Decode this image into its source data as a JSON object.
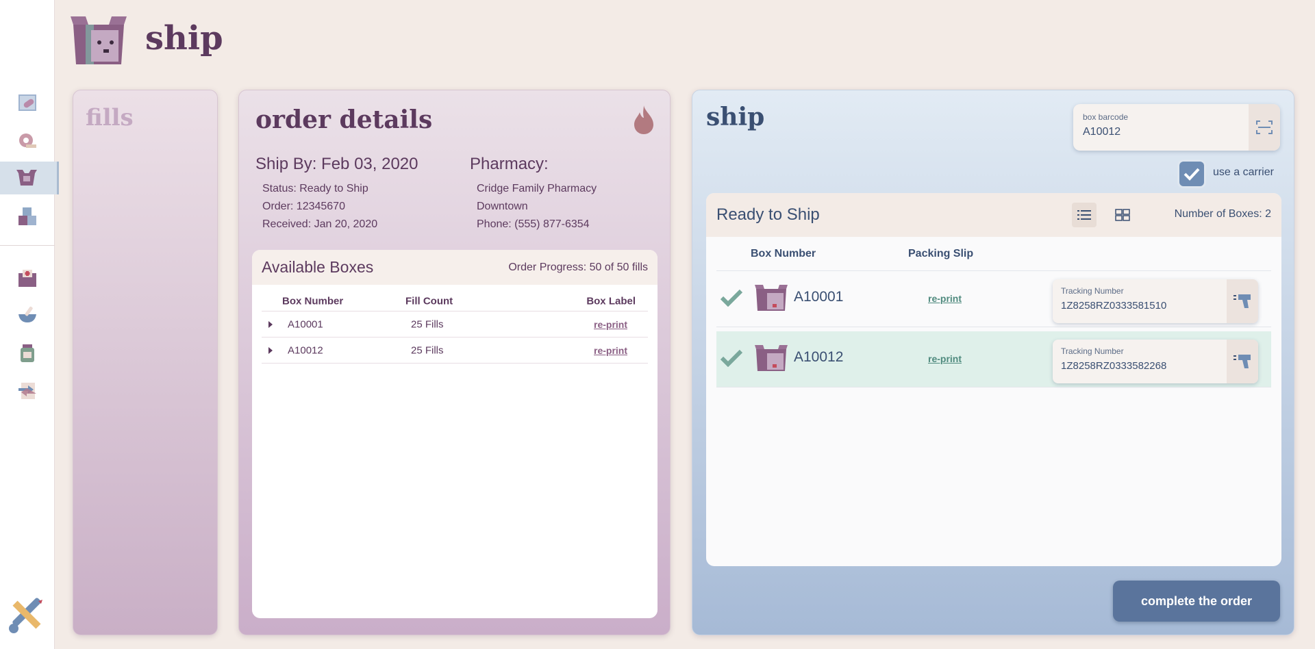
{
  "app": {
    "title": "ship"
  },
  "nav": {
    "items": [
      {
        "icon": "pill-card-icon"
      },
      {
        "icon": "tape-roll-icon"
      },
      {
        "icon": "ship-box-icon",
        "active": true
      },
      {
        "icon": "stacked-boxes-icon"
      },
      {
        "icon": "first-aid-box-icon"
      },
      {
        "icon": "mortar-pestle-icon"
      },
      {
        "icon": "medicine-jar-icon"
      },
      {
        "icon": "transfer-icon"
      }
    ],
    "tools_icon": "wrench-pencil-icon"
  },
  "fills": {
    "title": "fills"
  },
  "order": {
    "title": "order details",
    "ship_by": "Ship By: Feb 03, 2020",
    "status": "Status: Ready to Ship",
    "order_no": "Order: 12345670",
    "received": "Received: Jan 20, 2020",
    "pharmacy_heading": "Pharmacy:",
    "pharmacy_name": "Cridge Family Pharmacy",
    "pharmacy_branch": "Downtown",
    "pharmacy_phone": "Phone: (555) 877-6354",
    "boxes": {
      "title": "Available Boxes",
      "progress": "Order Progress: 50 of 50 fills",
      "columns": [
        "Box Number",
        "Fill Count",
        "Box Label"
      ],
      "rows": [
        {
          "box": "A10001",
          "count": "25 Fills",
          "label": "re-print"
        },
        {
          "box": "A10012",
          "count": "25 Fills",
          "label": "re-print"
        }
      ]
    }
  },
  "ship": {
    "title": "ship",
    "barcode_label": "box barcode",
    "barcode_value": "A10012",
    "carrier_label": "use a carrier",
    "carrier_checked": true,
    "ready": {
      "title": "Ready to Ship",
      "count_text": "Number of Boxes: 2",
      "columns": [
        "Box Number",
        "Packing Slip"
      ],
      "rows": [
        {
          "box": "A10001",
          "slip": "re-print",
          "tracking_label": "Tracking Number",
          "tracking": "1Z8258RZ0333581510",
          "highlighted": false
        },
        {
          "box": "A10012",
          "slip": "re-print",
          "tracking_label": "Tracking Number",
          "tracking": "1Z8258RZ0333582268",
          "highlighted": true
        }
      ]
    },
    "complete_label": "complete the order"
  },
  "colors": {
    "background": "#f3ebe6",
    "plum": "#5c3a5e",
    "navy": "#3a4f72",
    "accent_blue": "#5a749c",
    "success_green": "#7aa89c",
    "highlight_row": "#dff0ea"
  }
}
